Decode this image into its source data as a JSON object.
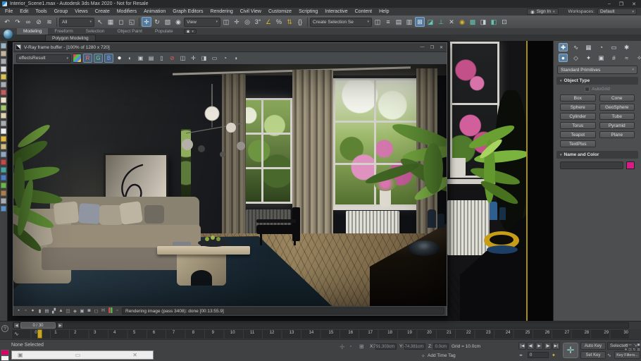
{
  "titlebar": {
    "title": "Interior_Scene1.max - Autodesk 3ds Max 2020 - Not for Resale",
    "minimize": "–",
    "maximize": "❐",
    "close": "✕"
  },
  "menubar": {
    "items": [
      "File",
      "Edit",
      "Tools",
      "Group",
      "Views",
      "Create",
      "Modifiers",
      "Animation",
      "Graph Editors",
      "Rendering",
      "Civil View",
      "Customize",
      "Scripting",
      "Interactive",
      "Content",
      "Help"
    ],
    "sign_in": "Sign In",
    "workspaces_label": "Workspaces:",
    "workspace": "Default",
    "arrow": "▾",
    "person": "◉"
  },
  "toolbar": {
    "groupA": [
      {
        "g": "↶"
      },
      {
        "g": "↷"
      },
      {
        "g": "∞"
      },
      {
        "g": "⊘"
      },
      {
        "g": "≋"
      }
    ],
    "all_dropdown": "All",
    "groupB": [
      {
        "g": "↖"
      },
      {
        "g": "▦"
      },
      {
        "g": "◻"
      },
      {
        "g": "◱"
      }
    ],
    "groupC": [
      {
        "g": "✛",
        "cls": "hl"
      },
      {
        "g": "↻"
      },
      {
        "g": "▧"
      },
      {
        "g": "◉"
      }
    ],
    "view_dropdown": "View",
    "groupD": [
      {
        "g": "◫"
      },
      {
        "g": "✛"
      },
      {
        "g": "◎"
      },
      {
        "g": "3°"
      },
      {
        "g": "∠",
        "cls": "gold"
      },
      {
        "g": "%"
      },
      {
        "g": "⇅",
        "cls": "gold"
      },
      {
        "g": "{}"
      }
    ],
    "selset_label": "Create Selection Se",
    "groupE": [
      {
        "g": "◫"
      },
      {
        "g": "≡"
      },
      {
        "g": "▤"
      },
      {
        "g": "▥"
      },
      {
        "g": "⊞",
        "cls": "hl"
      },
      {
        "g": "◪",
        "cls": "teal"
      },
      {
        "g": "⊥",
        "cls": "teal"
      },
      {
        "g": "✕"
      },
      {
        "g": "◉",
        "cls": "gold"
      },
      {
        "g": "▩",
        "cls": "teal"
      },
      {
        "g": "◨"
      },
      {
        "g": "◧",
        "cls": "teal"
      },
      {
        "g": "⊡"
      }
    ],
    "arrow": "▾"
  },
  "ribbon": {
    "tabs": [
      {
        "label": "Modeling",
        "cls": "active"
      },
      {
        "label": "Freeform"
      },
      {
        "label": "Selection"
      },
      {
        "label": "Object Paint"
      },
      {
        "label": "Populate"
      }
    ],
    "camera_dd": "▣",
    "subtab": "Polygon Modeling"
  },
  "leftbar": {
    "icons": [
      {
        "bg": "#9fb4c2"
      },
      {
        "bg": "#c2b49f"
      },
      {
        "bg": "#a8adb2"
      },
      {
        "bg": "#e0e0e0"
      },
      {
        "bg": "#d9c255"
      },
      {
        "bg": "#a8adb2"
      },
      {
        "bg": "#c25d5d"
      },
      {
        "bg": "#ece4cc"
      },
      {
        "bg": "#a4c66e"
      },
      {
        "bg": "#ded5ae"
      },
      {
        "bg": "#a8adb2"
      },
      {
        "bg": "#f0f0ee"
      },
      {
        "bg": "#e3bb3e"
      },
      {
        "bg": "#cdbd80"
      },
      {
        "bg": "#92a8c0"
      },
      {
        "bg": "#c04b4b"
      },
      {
        "bg": "#4aa4a4"
      },
      {
        "bg": "#4f7ec4"
      },
      {
        "bg": "#6cb44e"
      },
      {
        "bg": "#a87f4e"
      },
      {
        "bg": "#a8adb2"
      },
      {
        "bg": "#5f93c6"
      }
    ]
  },
  "vfb": {
    "title": "V-Ray frame buffer - [100% of 1280 x 720]",
    "channel": "effectsResult",
    "arrow": "▾",
    "minimize": "—",
    "maximize": "❐",
    "close": "✕",
    "tools": [
      {
        "g": "✿",
        "cls": "rainbow"
      },
      {
        "g": "R",
        "cls": "rbtn"
      },
      {
        "g": "G",
        "cls": "gbtn"
      },
      {
        "g": "B",
        "cls": "bbtn"
      },
      {
        "g": "●",
        "cls": "white"
      },
      {
        "g": "◐"
      },
      {
        "g": "▣"
      },
      {
        "g": "▤"
      },
      {
        "g": "▯"
      },
      {
        "g": "⊘",
        "cls": "red"
      },
      {
        "g": "◫"
      },
      {
        "g": "✛"
      },
      {
        "g": "◨"
      },
      {
        "g": "▭"
      },
      {
        "g": "◔"
      },
      {
        "g": "◑"
      }
    ],
    "status_icons": [
      {
        "g": "▪"
      },
      {
        "g": "▫"
      },
      {
        "g": "●"
      },
      {
        "g": "▮"
      },
      {
        "g": "▤"
      },
      {
        "g": "▞"
      },
      {
        "g": "▲"
      },
      {
        "g": "◫"
      },
      {
        "g": "◈"
      },
      {
        "g": "▣"
      },
      {
        "g": "◙"
      },
      {
        "g": "◻"
      },
      {
        "g": "H"
      },
      {
        "g": "▌",
        "cls": "rgb"
      },
      {
        "g": "▫"
      }
    ],
    "status": "Rendering image (pass 3408): done [00:13:55.9]"
  },
  "panel": {
    "tabs": [
      {
        "g": "✚",
        "cls": "active"
      },
      {
        "g": "∿"
      },
      {
        "g": "▦"
      },
      {
        "g": "◔"
      },
      {
        "g": "▭"
      },
      {
        "g": "✱"
      }
    ],
    "subtabs": [
      {
        "g": "●",
        "cls": "active"
      },
      {
        "g": "◇"
      },
      {
        "g": "✦"
      },
      {
        "g": "▣"
      },
      {
        "g": "#"
      },
      {
        "g": "≈"
      },
      {
        "g": "✧"
      }
    ],
    "category": "Standard Primitives",
    "arrow": "▾",
    "rollout1": "Object Type",
    "rollout1_mark": "▾",
    "autogrid": "AutoGrid",
    "obj_buttons": [
      "Box",
      "Cone",
      "Sphere",
      "GeoSphere",
      "Cylinder",
      "Tube",
      "Torus",
      "Pyramid",
      "Teapot",
      "Plane",
      "TextPlus"
    ],
    "rollout2": "Name and Color",
    "rollout2_mark": "▾",
    "swatch_color": "#da1a86"
  },
  "timeline": {
    "slider": "0 / 30",
    "prev": "◀",
    "next": "▶",
    "curve_icon": "∿",
    "help": "?",
    "ticks": [
      "0",
      "1",
      "2",
      "3",
      "4",
      "5",
      "6",
      "7",
      "8",
      "9",
      "10",
      "11",
      "12",
      "13",
      "14",
      "15",
      "16",
      "17",
      "18",
      "19",
      "20",
      "21",
      "22",
      "23",
      "24",
      "25",
      "26",
      "27",
      "28",
      "29",
      "30"
    ]
  },
  "statusbar": {
    "none_selected": "None Selected",
    "listener_icons": [
      {
        "g": "▣"
      },
      {
        "g": "▭"
      },
      {
        "g": "✕"
      }
    ],
    "lock_icon": "✛",
    "grid_icon": "⊞",
    "dot_icon": "▫",
    "x_label": "X:",
    "x_value": "791.303cm",
    "y_label": "Y:",
    "y_value": "-74.381cm",
    "z_label": "Z:",
    "z_value": "0.0cm",
    "grid_text": "Grid = 10.0cm",
    "tag_icon": "✧",
    "add_time_tag": "Add Time Tag",
    "play": [
      {
        "g": "|◀"
      },
      {
        "g": "◀|"
      },
      {
        "g": "▶"
      },
      {
        "g": "|▶"
      },
      {
        "g": "▶|"
      }
    ],
    "speed_icon": "◂▸",
    "frame": "0",
    "key_icon": "✦",
    "big_plus": "✛",
    "auto_key": "Auto Key",
    "set_key": "Set Key",
    "sel_dropdown": "Selected",
    "curve_icon": "∿",
    "key_filters": "Key Filters...",
    "nav": [
      {
        "g": "±"
      },
      {
        "g": "▭"
      },
      {
        "g": "◔"
      },
      {
        "g": "▣"
      },
      {
        "g": "✛"
      },
      {
        "g": "◳"
      },
      {
        "g": "↻"
      },
      {
        "g": "⊡"
      }
    ]
  }
}
